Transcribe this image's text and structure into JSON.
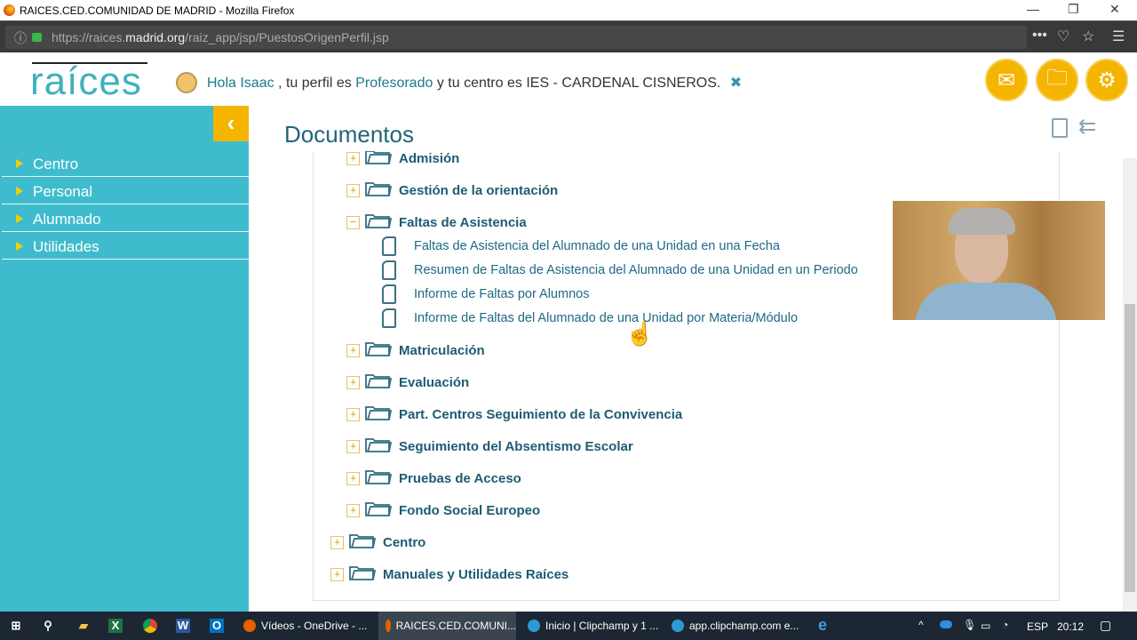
{
  "window": {
    "title": "RAICES.CED.COMUNIDAD DE MADRID - Mozilla Firefox"
  },
  "browser": {
    "url_prefix": "https://raices.",
    "url_domain": "madrid.org",
    "url_path": "/raiz_app/jsp/PuestosOrigenPerfil.jsp"
  },
  "header": {
    "logo": "raíces",
    "hello": "Hola Isaac",
    "profile_pre": ", tu perfil es",
    "profile": "Profesorado",
    "center_text": "y tu centro es IES - CARDENAL CISNEROS.",
    "close_icon": "✖"
  },
  "sidebar": {
    "items": [
      {
        "label": "Centro"
      },
      {
        "label": "Personal"
      },
      {
        "label": "Alumnado"
      },
      {
        "label": "Utilidades"
      }
    ]
  },
  "main": {
    "title": "Documentos",
    "tree": [
      {
        "label": "Admisión",
        "level": 1,
        "expanded": false
      },
      {
        "label": "Gestión de la orientación",
        "level": 1,
        "expanded": false
      },
      {
        "label": "Faltas de Asistencia",
        "level": 1,
        "expanded": true,
        "children": [
          "Faltas de Asistencia del Alumnado de una Unidad en una Fecha",
          "Resumen de Faltas de Asistencia del Alumnado de una Unidad en un Periodo",
          "Informe de Faltas por Alumnos",
          "Informe de Faltas del Alumnado de una Unidad por Materia/Módulo"
        ]
      },
      {
        "label": "Matriculación",
        "level": 1,
        "expanded": false
      },
      {
        "label": "Evaluación",
        "level": 1,
        "expanded": false
      },
      {
        "label": "Part. Centros Seguimiento de la Convivencia",
        "level": 1,
        "expanded": false
      },
      {
        "label": "Seguimiento del Absentismo Escolar",
        "level": 1,
        "expanded": false
      },
      {
        "label": "Pruebas de Acceso",
        "level": 1,
        "expanded": false
      },
      {
        "label": "Fondo Social Europeo",
        "level": 1,
        "expanded": false
      },
      {
        "label": "Centro",
        "level": 0,
        "expanded": false
      },
      {
        "label": "Manuales y Utilidades Raíces",
        "level": 0,
        "expanded": false
      }
    ]
  },
  "taskbar": {
    "items": [
      {
        "label": "Vídeos - OneDrive - ..."
      },
      {
        "label": "RAICES.CED.COMUNI..."
      },
      {
        "label": "Inicio | Clipchamp y 1 ..."
      },
      {
        "label": "app.clipchamp.com e..."
      }
    ],
    "lang": "ESP",
    "time": "20:12"
  },
  "colors": {
    "teal": "#3ebccd",
    "accent": "#f4b400"
  }
}
